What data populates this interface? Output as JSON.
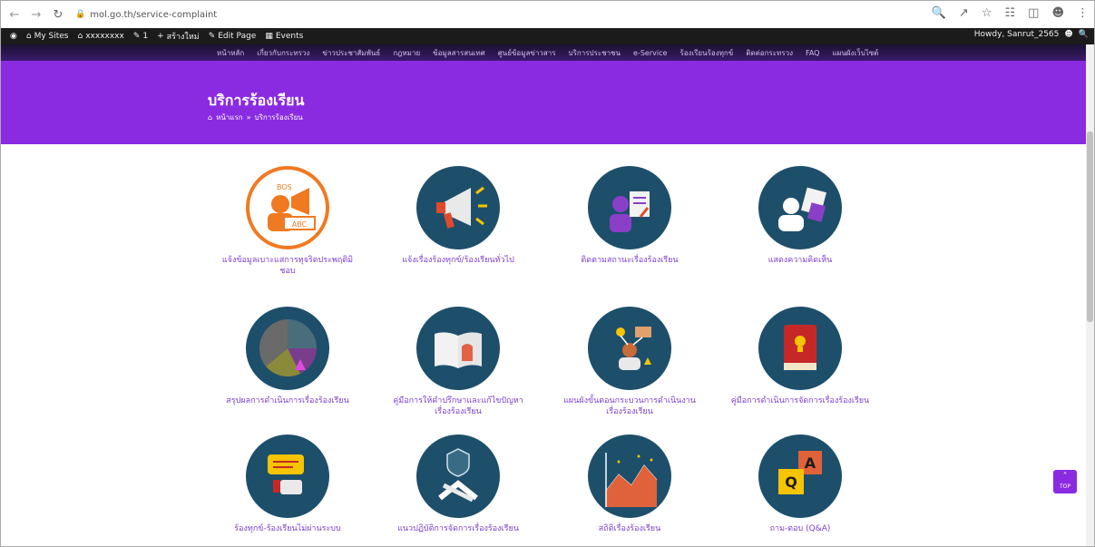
{
  "browser": {
    "url": "mol.go.th/service-complaint",
    "bookmarks": [
      "My Sites",
      "xxxxxxxx",
      "1",
      "สร้างใหม่",
      "Edit Page",
      "Events"
    ],
    "account": "Howdy, Sanrut_2565"
  },
  "site_nav": {
    "items": [
      "หน้าหลัก",
      "เกี่ยวกับกระทรวง",
      "ข่าวประชาสัมพันธ์",
      "กฎหมาย",
      "ข้อมูลสารสนเทศ",
      "ศูนย์ข้อมูลข่าวสาร",
      "บริการประชาชน",
      "e-Service",
      "ร้องเรียนร้องทุกข์",
      "ติดต่อกระทรวง",
      "FAQ",
      "แผนผังเว็บไซต์"
    ]
  },
  "hero": {
    "title": "บริการร้องเรียน",
    "breadcrumb": [
      "หน้าแรก",
      "บริการร้องเรียน"
    ]
  },
  "services": [
    {
      "label": "แจ้งข้อมูลเบาะแสการทุจริตประพฤติมิชอบ",
      "icon": "report-corruption-icon",
      "color": "#ffffff"
    },
    {
      "label": "แจ้งเรื่องร้องทุกข์/ร้องเรียนทั่วไป",
      "icon": "megaphone-icon",
      "color": "#1d4f6b"
    },
    {
      "label": "ติดตามสถานะเรื่องร้องเรียน",
      "icon": "status-tracking-icon",
      "color": "#1d4f6b"
    },
    {
      "label": "แสดงความคิดเห็น",
      "icon": "feedback-icon",
      "color": "#1d4f6b"
    },
    {
      "label": "สรุปผลการดำเนินการเรื่องร้องเรียน",
      "icon": "pie-summary-icon",
      "color": "#1d4f6b"
    },
    {
      "label": "คู่มือการให้คำปรึกษาและแก้ไขปัญหาเรื่องร้องเรียน",
      "icon": "manual-book-icon",
      "color": "#1d4f6b"
    },
    {
      "label": "แผนผังขั้นตอนกระบวนการดำเนินงานเรื่องร้องเรียน",
      "icon": "process-flow-icon",
      "color": "#1d4f6b"
    },
    {
      "label": "คู่มือการดำเนินการจัดการเรื่องร้องเรียน",
      "icon": "red-book-icon",
      "color": "#1d4f6b"
    },
    {
      "label": "ร้องทุกข์-ร้องเรียนไม่ผ่านระบบ",
      "icon": "thumbs-down-chat-icon",
      "color": "#1d4f6b"
    },
    {
      "label": "แนวปฏิบัติการจัดการเรื่องร้องเรียน",
      "icon": "shield-handshake-icon",
      "color": "#1d4f6b"
    },
    {
      "label": "สถิติเรื่องร้องเรียน",
      "icon": "statistics-chart-icon",
      "color": "#1d4f6b"
    },
    {
      "label": "ถาม-ตอบ (Q&A)",
      "icon": "qa-icon",
      "color": "#1d4f6b"
    }
  ],
  "back_to_top": "TOP"
}
